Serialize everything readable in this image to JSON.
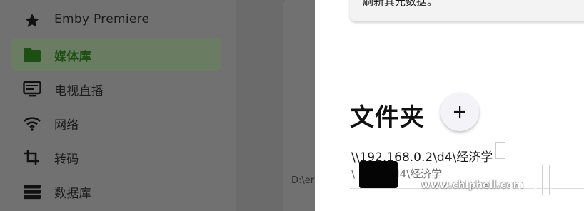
{
  "sidebar": {
    "items": [
      {
        "label": "Emby Premiere",
        "icon": "star-icon"
      },
      {
        "label": "媒体库",
        "icon": "folder-icon"
      },
      {
        "label": "电视直播",
        "icon": "live-tv-icon"
      },
      {
        "label": "网络",
        "icon": "wifi-icon"
      },
      {
        "label": "转码",
        "icon": "crop-icon"
      },
      {
        "label": "数据库",
        "icon": "database-icon"
      }
    ]
  },
  "panel": {
    "path_fragment": "D:\\er"
  },
  "dialog": {
    "note": "刷新其元数据。",
    "section_title": "文件夹",
    "add_icon": "plus-icon",
    "folder_path": "\\\\192.168.0.2\\d4\\经济学",
    "folder_sub_prefix": "\\",
    "folder_sub_suffix": "\\d4\\经济学"
  },
  "watermark": {
    "url": "www.chiphell.com",
    "logo_text": "chiphell"
  },
  "colors": {
    "active_item_bg": "#6a7d62",
    "active_item_text": "#1e4f12",
    "dialog_bg": "#ffffff"
  }
}
